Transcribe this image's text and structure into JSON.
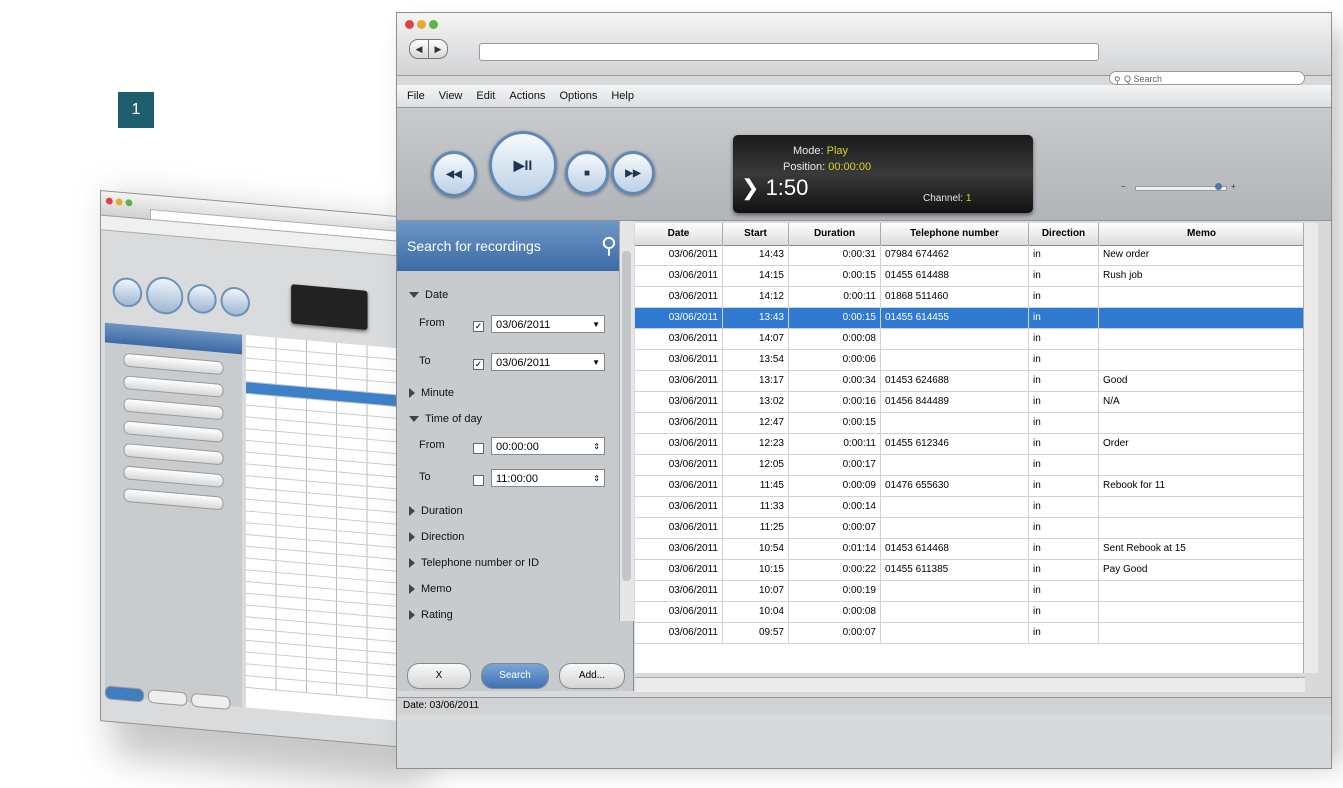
{
  "badge": "1",
  "browser": {
    "back_label": "◀",
    "forward_label": "▶",
    "search_placeholder": "Q Search",
    "menu": [
      "File",
      "View",
      "Edit",
      "Actions",
      "Options",
      "Help"
    ]
  },
  "player": {
    "prev_label": "◀◀",
    "play_label": "▶II",
    "stop_label": "■",
    "next_label": "▶▶",
    "line1_label": "Mode:",
    "line1_value": "Play",
    "line2_label": "Position:",
    "line2_value": "00:00:00",
    "time": "1:50",
    "line3_label": "Channel:",
    "line3_value": "1",
    "vol_low": "−",
    "vol_high": "+"
  },
  "search_panel": {
    "title": "Search for recordings",
    "date_label": "Date",
    "from_label": "From",
    "from_value": "03/06/2011",
    "to_label": "To",
    "to_value": "03/06/2011",
    "minute_label": "Minute",
    "time_of_day_label": "Time of day",
    "tod_from_label": "From",
    "tod_from_value": "00:00:00",
    "tod_to_label": "To",
    "tod_to_value": "11:00:00",
    "duration_label": "Duration",
    "direction_label": "Direction",
    "telephone_label": "Telephone number or ID",
    "memo_label": "Memo",
    "rating_label": "Rating",
    "btn_clear": "X",
    "btn_search": "Search",
    "btn_more": "Add..."
  },
  "table": {
    "columns": [
      "Date",
      "Start",
      "Duration",
      "Telephone number",
      "Direction",
      "Memo"
    ],
    "rows": [
      [
        "03/06/2011",
        "14:43",
        "0:00:31",
        "07984 674462",
        "in",
        "New order"
      ],
      [
        "03/06/2011",
        "14:15",
        "0:00:15",
        "01455 614488",
        "in",
        "Rush job"
      ],
      [
        "03/06/2011",
        "14:12",
        "0:00:11",
        "01868 511460",
        "in",
        ""
      ],
      [
        "03/06/2011",
        "13:43",
        "0:00:15",
        "01455 614455",
        "in",
        ""
      ],
      [
        "03/06/2011",
        "14:07",
        "0:00:08",
        "",
        "in",
        ""
      ],
      [
        "03/06/2011",
        "13:54",
        "0:00:06",
        "",
        "in",
        ""
      ],
      [
        "03/06/2011",
        "13:17",
        "0:00:34",
        "01453 624688",
        "in",
        "Good"
      ],
      [
        "03/06/2011",
        "13:02",
        "0:00:16",
        "01456 844489",
        "in",
        "N/A"
      ],
      [
        "03/06/2011",
        "12:47",
        "0:00:15",
        "",
        "in",
        ""
      ],
      [
        "03/06/2011",
        "12:23",
        "0:00:11",
        "01455 612346",
        "in",
        "Order"
      ],
      [
        "03/06/2011",
        "12:05",
        "0:00:17",
        "",
        "in",
        ""
      ],
      [
        "03/06/2011",
        "11:45",
        "0:00:09",
        "01476 655630",
        "in",
        "Rebook for 11"
      ],
      [
        "03/06/2011",
        "11:33",
        "0:00:14",
        "",
        "in",
        ""
      ],
      [
        "03/06/2011",
        "11:25",
        "0:00:07",
        "",
        "in",
        ""
      ],
      [
        "03/06/2011",
        "10:54",
        "0:01:14",
        "01453 614468",
        "in",
        "Sent Rebook at 15"
      ],
      [
        "03/06/2011",
        "10:15",
        "0:00:22",
        "01455 611385",
        "in",
        "Pay Good"
      ],
      [
        "03/06/2011",
        "10:07",
        "0:00:19",
        "",
        "in",
        ""
      ],
      [
        "03/06/2011",
        "10:04",
        "0:00:08",
        "",
        "in",
        ""
      ],
      [
        "03/06/2011",
        "09:57",
        "0:00:07",
        "",
        "in",
        ""
      ]
    ],
    "selected_row": 3
  },
  "status_text": "Date: 03/06/2011",
  "colors": {
    "accent": "#3c6ba4",
    "selection": "#2f7ad0",
    "badge": "#1f5e6d"
  }
}
